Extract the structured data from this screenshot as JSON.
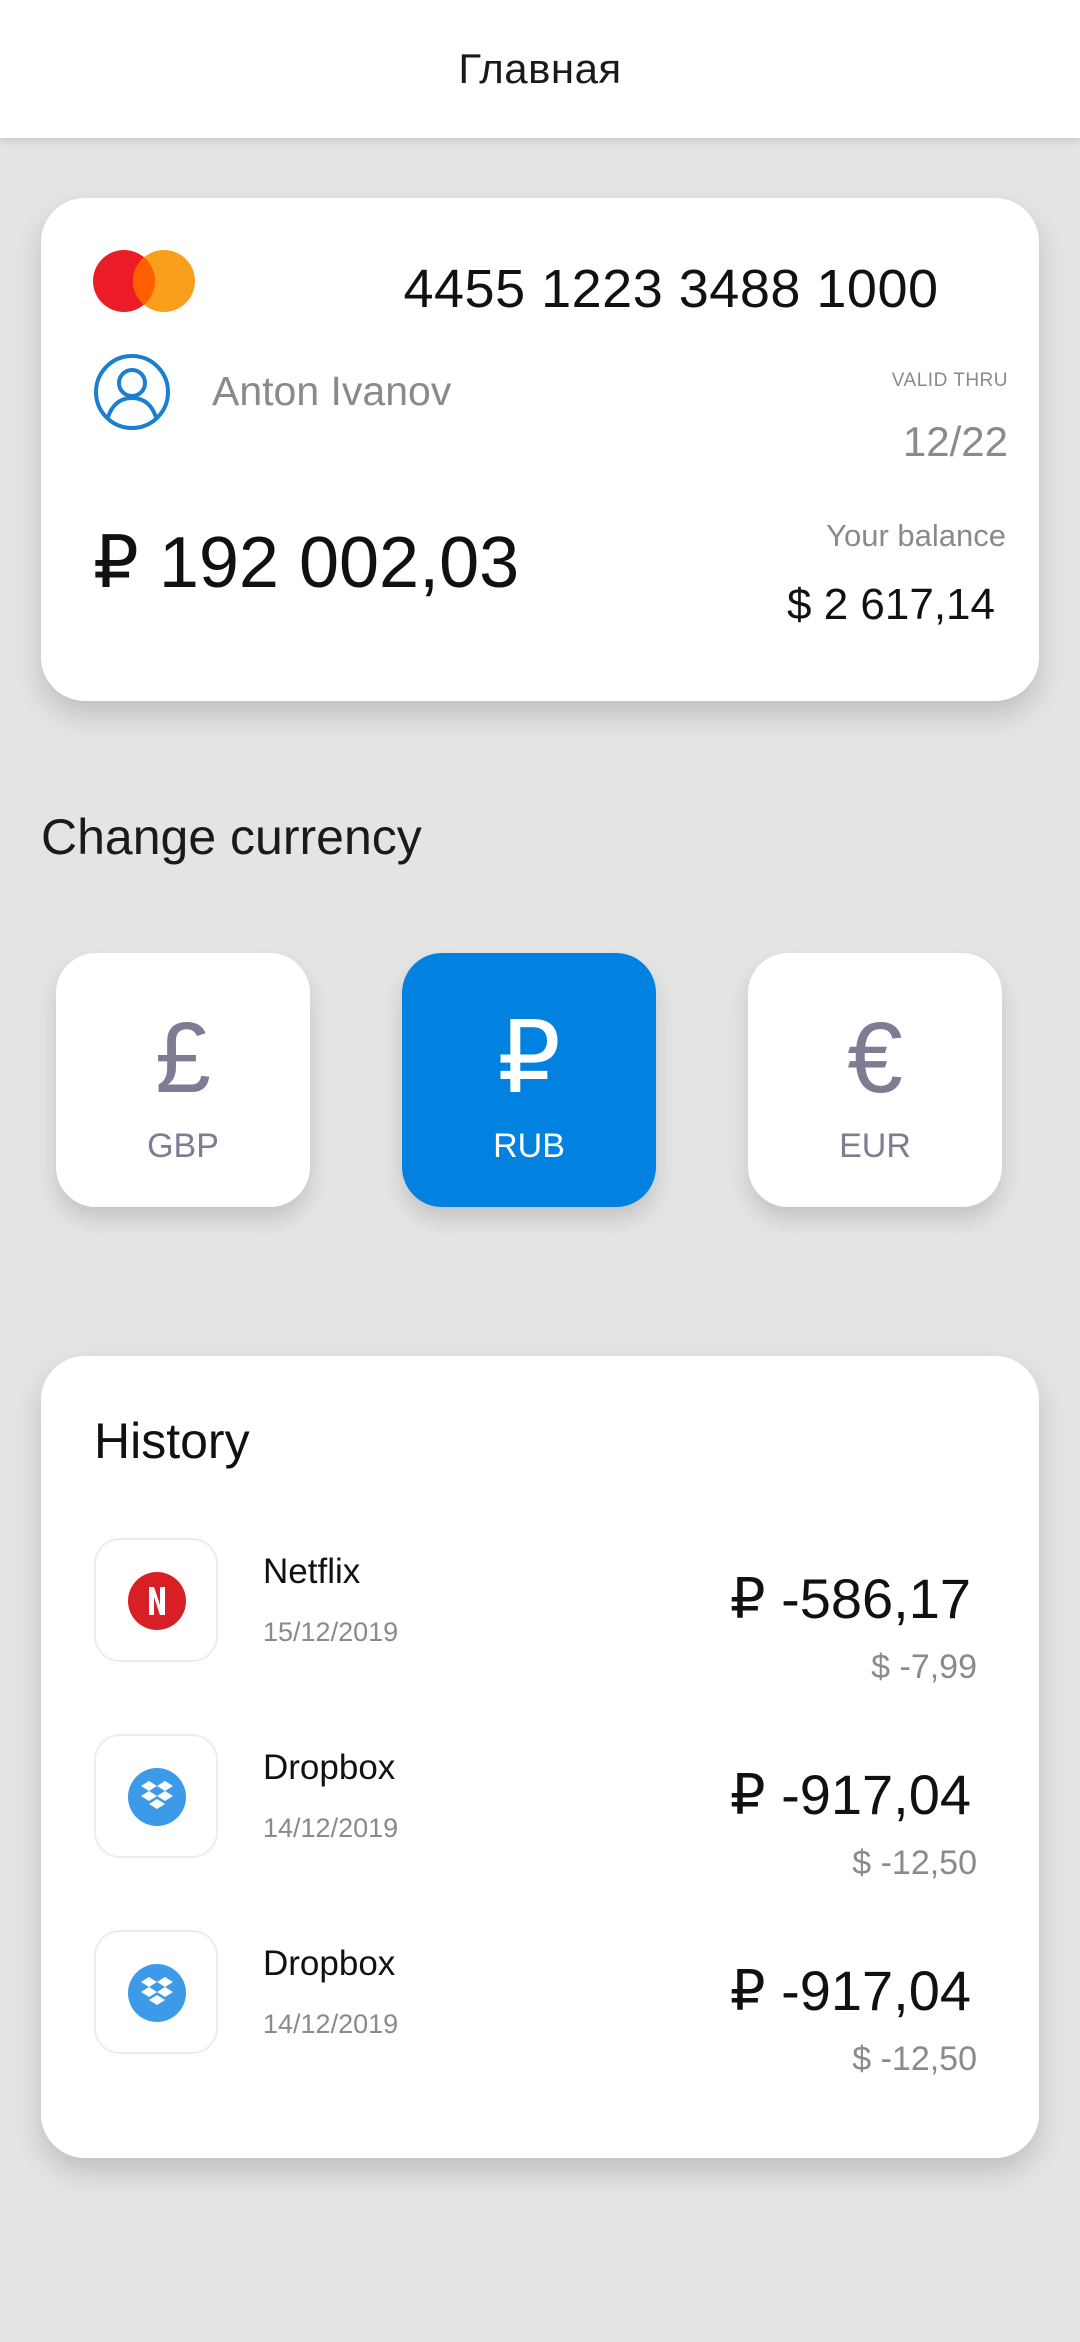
{
  "topbar": {
    "title": "Главная"
  },
  "card": {
    "number": "4455 1223 3488 1000",
    "holder": "Anton Ivanov",
    "valid_label": "VALID THRU",
    "valid_value": "12/22",
    "balance": "₽ 192 002,03",
    "balance_label": "Your balance",
    "balance_usd": "$ 2 617,14",
    "logo_icon": "mastercard-logo",
    "user_icon": "user-circle-icon",
    "colors": {
      "mc_red": "#eb1c26",
      "mc_orange": "#f99f1b",
      "user_icon": "#1a7fd0"
    }
  },
  "currency": {
    "heading": "Change currency",
    "selected": "RUB",
    "options": [
      {
        "symbol": "£",
        "code": "GBP"
      },
      {
        "symbol": "₽",
        "code": "RUB"
      },
      {
        "symbol": "€",
        "code": "EUR"
      }
    ],
    "colors": {
      "active_bg": "#0282e0",
      "inactive_text": "#7e7b93"
    }
  },
  "history": {
    "title": "History",
    "items": [
      {
        "name": "Netflix",
        "date": "15/12/2019",
        "amount": "₽ -586,17",
        "usd": "$ -7,99",
        "icon": "netflix-icon"
      },
      {
        "name": "Dropbox",
        "date": "14/12/2019",
        "amount": "₽ -917,04",
        "usd": "$ -12,50",
        "icon": "dropbox-icon"
      },
      {
        "name": "Dropbox",
        "date": "14/12/2019",
        "amount": "₽ -917,04",
        "usd": "$ -12,50",
        "icon": "dropbox-icon"
      }
    ],
    "colors": {
      "netflix": "#d81f26",
      "dropbox": "#3d9ae8"
    }
  }
}
